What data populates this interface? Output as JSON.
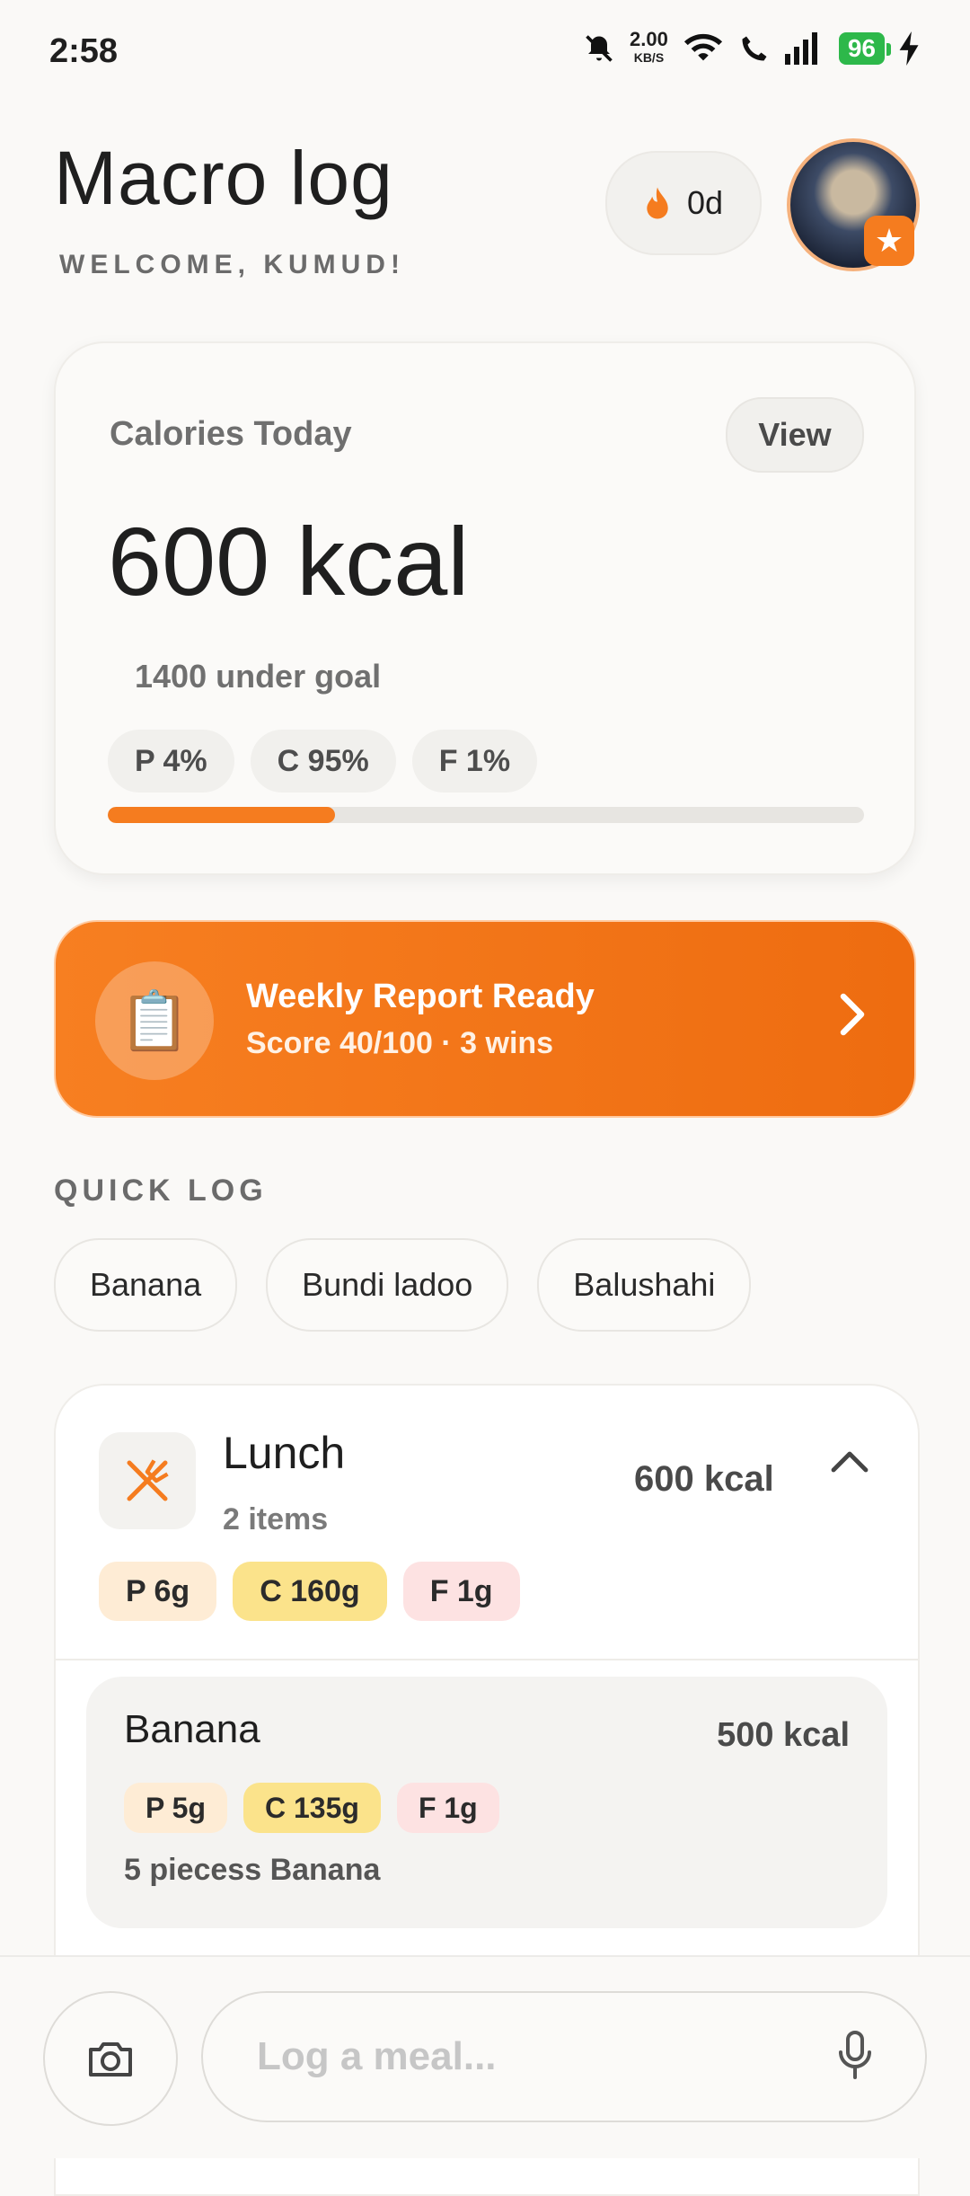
{
  "status": {
    "time": "2:58",
    "net_speed": "2.00",
    "net_unit": "KB/S",
    "battery": "96"
  },
  "header": {
    "title": "Macro log",
    "subtitle": "WELCOME, KUMUD!",
    "streak": "0d"
  },
  "calories": {
    "label": "Calories Today",
    "view_label": "View",
    "value": "600 kcal",
    "under_goal": "1400 under goal",
    "macros": [
      "P 4%",
      "C 95%",
      "F 1%"
    ],
    "progress_fraction": 0.3
  },
  "report": {
    "title": "Weekly Report Ready",
    "subtitle": "Score 40/100 · 3 wins"
  },
  "quick_log": {
    "label": "QUICK LOG",
    "items": [
      "Banana",
      "Bundi ladoo",
      "Balushahi"
    ]
  },
  "meal": {
    "title": "Lunch",
    "items_count": "2 items",
    "kcal": "600 kcal",
    "tags": {
      "p": "P 6g",
      "c": "C 160g",
      "f": "F 1g"
    },
    "entries": [
      {
        "name": "Banana",
        "kcal": "500 kcal",
        "tags": {
          "p": "P 5g",
          "c": "C 135g",
          "f": "F 1g"
        },
        "desc": "5 piecess Banana"
      }
    ]
  },
  "composer": {
    "placeholder": "Log a meal..."
  },
  "colors": {
    "accent": "#f57c1f",
    "protein": "#feecd5",
    "carbs": "#fbe38b",
    "fat": "#fde2e2",
    "battery": "#2db84a"
  }
}
